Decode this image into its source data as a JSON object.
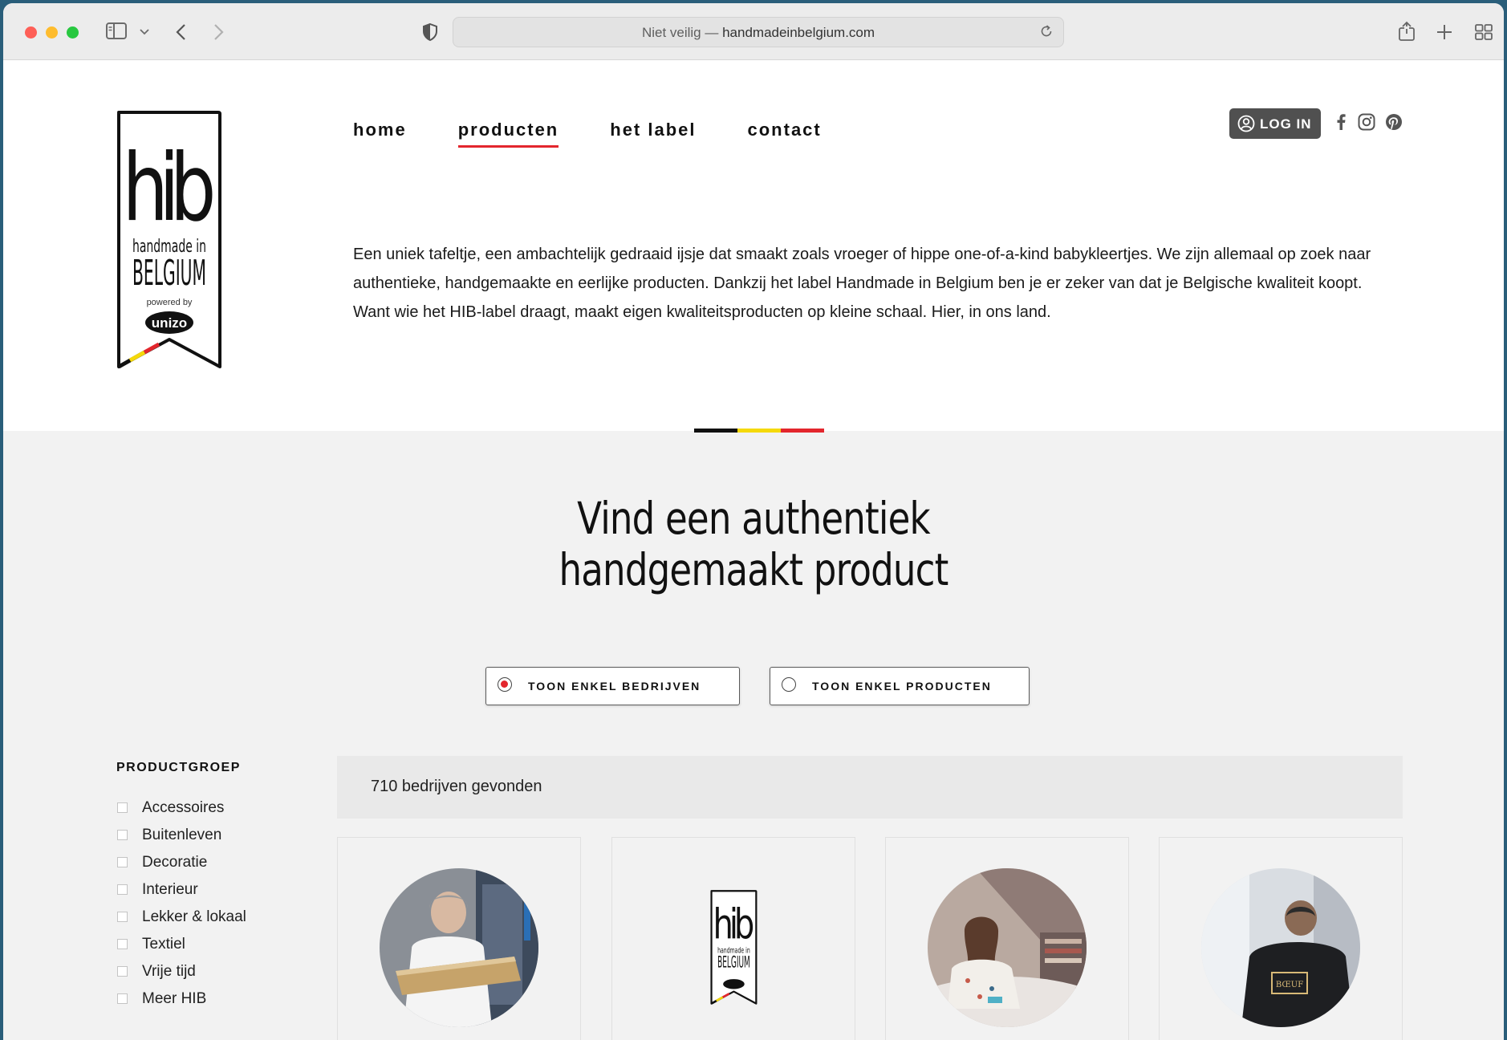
{
  "browser": {
    "url_prefix": "Niet veilig —",
    "url_domain": "handmadeinbelgium.com"
  },
  "logo": {
    "main": "hib",
    "line1": "handmade in",
    "line2": "BELGIUM",
    "powered_by": "powered by",
    "brand": "unizo"
  },
  "nav": {
    "items": [
      {
        "label": "home"
      },
      {
        "label": "producten"
      },
      {
        "label": "het label"
      },
      {
        "label": "contact"
      }
    ]
  },
  "header": {
    "login_label": "LOG IN",
    "intro": "Een uniek tafeltje, een ambachtelijk gedraaid ijsje dat smaakt zoals vroeger of hippe one-of-a-kind babykleertjes. We zijn allemaal op zoek naar authentieke, handgemaakte en eerlijke producten. Dankzij het label Handmade in Belgium ben je er zeker van dat je Belgische kwaliteit koopt. Want wie het HIB-label draagt, maakt eigen kwaliteitsproducten op kleine schaal. Hier, in ons land."
  },
  "main": {
    "headline_line1": "Vind een authentiek",
    "headline_line2": "handgemaakt product",
    "toggle_companies": "TOON ENKEL BEDRIJVEN",
    "toggle_products": "TOON ENKEL PRODUCTEN",
    "results_count": "710 bedrijven gevonden"
  },
  "sidebar": {
    "title": "PRODUCTGROEP",
    "items": [
      {
        "label": "Accessoires"
      },
      {
        "label": "Buitenleven"
      },
      {
        "label": "Decoratie"
      },
      {
        "label": "Interieur"
      },
      {
        "label": "Lekker & lokaal"
      },
      {
        "label": "Textiel"
      },
      {
        "label": "Vrije tijd"
      },
      {
        "label": "Meer HIB"
      }
    ]
  },
  "colors": {
    "accent_red": "#e3262d",
    "flag_black": "#111111",
    "flag_yellow": "#f5d90a",
    "flag_red": "#e3262d"
  }
}
